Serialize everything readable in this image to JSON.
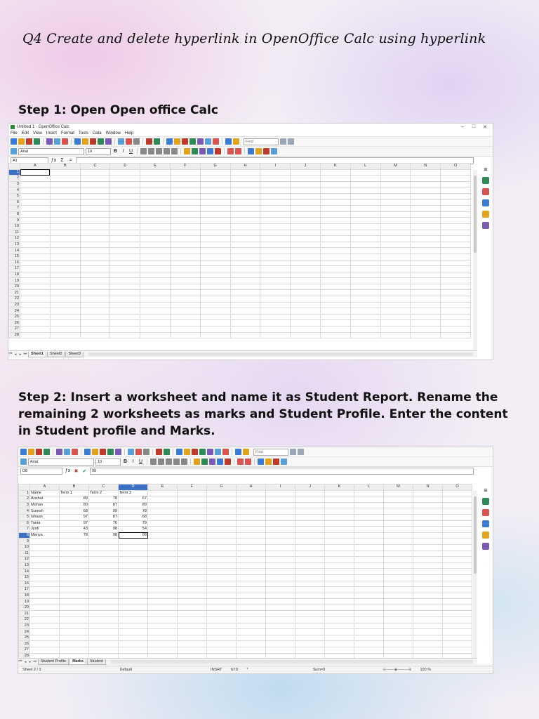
{
  "page": {
    "title": "Q4 Create and delete hyperlink in OpenOffice Calc using hyperlink",
    "step1": "Step 1: Open Open office Calc",
    "step2": "Step 2: Insert a worksheet and name it as Student Report. Rename the remaining 2 worksheets as marks and Student Profile. Enter the content in Student profile and Marks."
  },
  "screenshot1": {
    "window_title": "Untitled 1 - OpenOffice Calc",
    "window_buttons": [
      "–",
      "□",
      "✕"
    ],
    "menu": [
      "File",
      "Edit",
      "View",
      "Insert",
      "Format",
      "Tools",
      "Data",
      "Window",
      "Help"
    ],
    "find_placeholder": "Find",
    "font_name": "Arial",
    "font_size": "10",
    "name_box": "A1",
    "formula": "",
    "columns": [
      "A",
      "B",
      "C",
      "D",
      "E",
      "F",
      "G",
      "H",
      "I",
      "J",
      "K",
      "L",
      "M",
      "N",
      "O"
    ],
    "row_count": 28,
    "selected_cell": "A1",
    "sheet_tabs": [
      "Sheet1",
      "Sheet2",
      "Sheet3"
    ],
    "active_tab": "Sheet1"
  },
  "screenshot2": {
    "find_placeholder": "Find",
    "font_name": "Arial",
    "font_size": "10",
    "name_box": "D8",
    "formula": "99",
    "columns": [
      "A",
      "B",
      "C",
      "D",
      "E",
      "F",
      "G",
      "H",
      "I",
      "J",
      "K",
      "L",
      "M",
      "N",
      "O"
    ],
    "selected_column": "D",
    "selected_row": 8,
    "row_count": 28,
    "table": {
      "headers": [
        "Name",
        "Term 1",
        "Term 2",
        "Term 3"
      ],
      "rows": [
        [
          "Anshul",
          "89",
          "78",
          "67"
        ],
        [
          "Mohan",
          "80",
          "87",
          "89"
        ],
        [
          "Suresh",
          "68",
          "99",
          "78"
        ],
        [
          "Ishaan",
          "97",
          "87",
          "68"
        ],
        [
          "Tania",
          "97",
          "76",
          "79"
        ],
        [
          "Jyoti",
          "43",
          "98",
          "54"
        ],
        [
          "Manya",
          "78",
          "98",
          "99"
        ]
      ]
    },
    "sheet_tabs": [
      "Student Profile",
      "Marks",
      "Student"
    ],
    "active_tab": "Marks",
    "status": {
      "sheet": "Sheet 2 / 3",
      "style": "Default",
      "insert_mode": "INSRT",
      "selection_mode": "STD",
      "modified": "*",
      "sum": "Sum=0",
      "zoom": "100 %"
    }
  },
  "icon_colors": [
    "#3b7bd6",
    "#e2a21b",
    "#c0392b",
    "#2e8b57",
    "#7a5ab5",
    "#5aa0d8",
    "#d9534f",
    "#888888"
  ]
}
